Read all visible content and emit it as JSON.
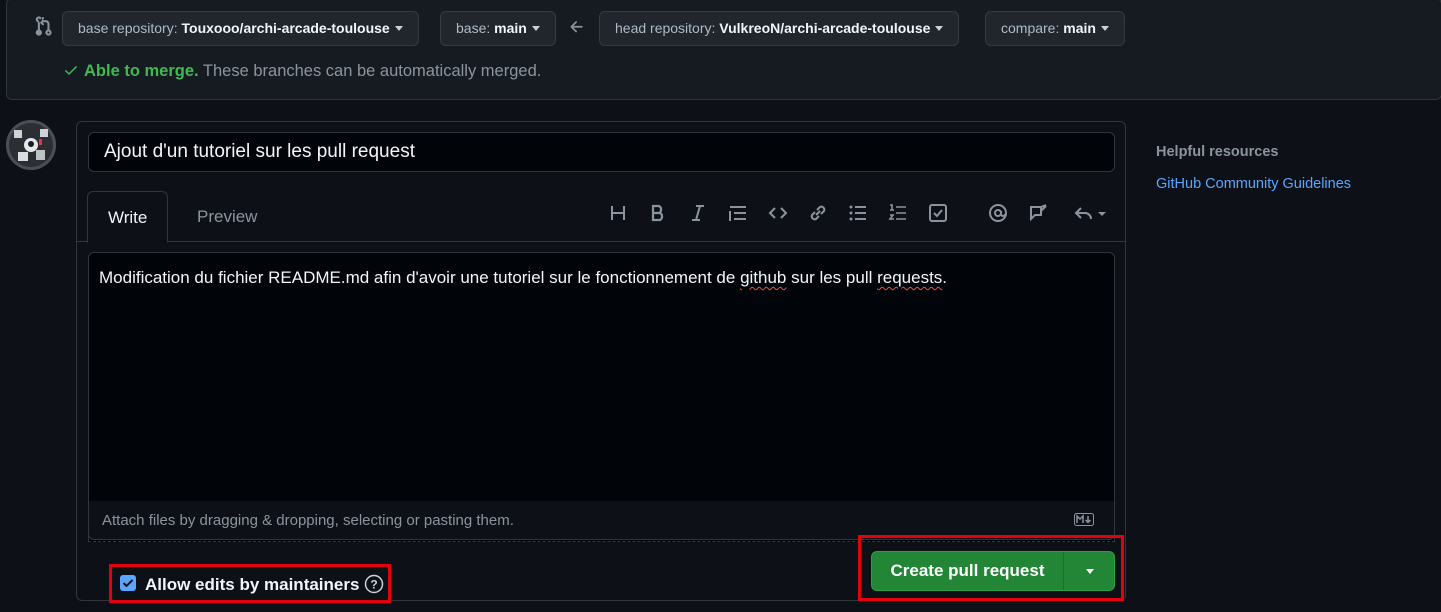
{
  "compare": {
    "base_repo_label": "base repository:",
    "base_repo_value": "Touxooo/archi-arcade-toulouse",
    "base_label": "base:",
    "base_value": "main",
    "head_repo_label": "head repository:",
    "head_repo_value": "VulkreoN/archi-arcade-toulouse",
    "compare_label": "compare:",
    "compare_value": "main",
    "merge_status": "Able to merge.",
    "merge_desc": "These branches can be automatically merged."
  },
  "pr": {
    "title": "Ajout d'un tutoriel sur les pull request",
    "tabs": [
      "Write",
      "Preview"
    ],
    "body_parts": [
      "Modification du fichier README.md afin d'avoir une tutoriel sur le fonctionnement de ",
      "github",
      " sur les pull ",
      "requests",
      "."
    ],
    "attach_hint": "Attach files by dragging & dropping, selecting or pasting them.",
    "allow_edits_label": "Allow edits by maintainers",
    "allow_edits_checked": true,
    "create_button": "Create pull request"
  },
  "toolbar": {
    "icons": [
      "heading-icon",
      "bold-icon",
      "italic-icon",
      "quote-icon",
      "code-icon",
      "link-icon",
      "bulleted-list-icon",
      "numbered-list-icon",
      "task-list-icon",
      "mention-icon",
      "cross-reference-icon",
      "reply-icon"
    ]
  },
  "sidebar": {
    "heading": "Helpful resources",
    "link": "GitHub Community Guidelines"
  },
  "colors": {
    "background": "#0d1117",
    "success": "#3fb950",
    "primary_button": "#238636",
    "link": "#58a6ff",
    "highlight_box": "#e5000e"
  }
}
